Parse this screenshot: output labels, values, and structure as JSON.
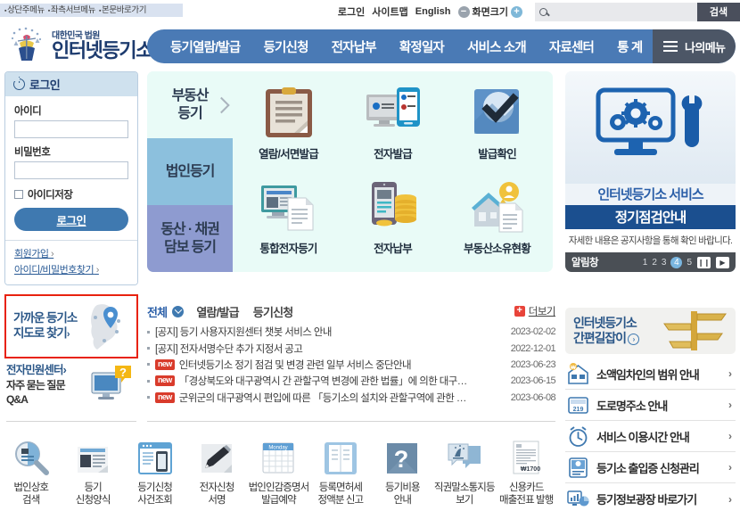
{
  "skip_links": [
    "상단주메뉴",
    "좌측서브메뉴",
    "본문바로가기"
  ],
  "utility": {
    "login": "로그인",
    "sitemap": "사이트맵",
    "english": "English",
    "zoom_label": "화면크기",
    "zoom_out": "−",
    "zoom_in": "+",
    "search_placeholder": "",
    "search_value": "",
    "search_button": "검색"
  },
  "logo": {
    "sub": "대한민국 법원",
    "main": "인터넷등기소"
  },
  "nav": {
    "items": [
      "등기열람/발급",
      "등기신청",
      "전자납부",
      "확정일자",
      "서비스 소개",
      "자료센터",
      "통 계"
    ],
    "mymenu": "나의메뉴"
  },
  "login_panel": {
    "title": "로그인",
    "id_label": "아이디",
    "id_value": "",
    "pw_label": "비밀번호",
    "pw_value": "",
    "remember_label": "아이디저장",
    "submit": "로그인",
    "links": [
      "회원가입",
      "아이디/비밀번호찾기"
    ]
  },
  "sidebar": {
    "map_promo": {
      "line1": "가까운 등기소",
      "line2": "지도로 찾기",
      "arrow": "›"
    },
    "eminwon": {
      "line1": "전자민원센터",
      "arrow": "›",
      "line2": "자주 묻는 질문",
      "line3": "Q&A"
    }
  },
  "visual": {
    "tabs": [
      {
        "label": "부동산\n등기",
        "active": true
      },
      {
        "label": "법인등기",
        "active": false
      },
      {
        "label": "동산 · 채권\n담보 등기",
        "active": false
      }
    ],
    "cells": [
      {
        "label": "열람/서면발급",
        "icon": "clipboard-document-icon"
      },
      {
        "label": "전자발급",
        "icon": "monitor-mobile-icon"
      },
      {
        "label": "발급확인",
        "icon": "checkmark-icon"
      },
      {
        "label": "통합전자등기",
        "icon": "monitor-paper-icon"
      },
      {
        "label": "전자납부",
        "icon": "mobile-coins-icon"
      },
      {
        "label": "부동산소유현황",
        "icon": "house-person-icon"
      }
    ]
  },
  "rbanner": {
    "title1": "인터넷등기소 서비스",
    "title2": "정기점검안내",
    "desc": "자세한 내용은 공지사항을 통해 확인 바랍니다.",
    "bar_label": "알림창",
    "pages": [
      "1",
      "2",
      "3",
      "4",
      "5"
    ],
    "active_page": "4",
    "pause": "❙❙",
    "next": "▶"
  },
  "notice": {
    "tabs": [
      {
        "label": "전체",
        "active": true
      },
      {
        "label": "열람/발급",
        "active": false
      },
      {
        "label": "등기신청",
        "active": false
      }
    ],
    "more_label": "더보기",
    "more_plus": "+",
    "items": [
      {
        "badge": "",
        "prefix": "[공지]",
        "text": "[공지] 등기 사용자지원센터 챗봇 서비스 안내",
        "date": "2023-02-02"
      },
      {
        "badge": "",
        "prefix": "[공지]",
        "text": "[공지] 전자서명수단 추가 지정서 공고",
        "date": "2022-12-01"
      },
      {
        "badge": "new",
        "prefix": "",
        "text": "인터넷등기소 정기 점검 및 변경 관련 일부 서비스 중단안내",
        "date": "2023-06-23"
      },
      {
        "badge": "new",
        "prefix": "",
        "text": "「경상북도와 대구광역시 간 관할구역 변경에 관한 법률」에 의한 대구…",
        "date": "2023-06-15"
      },
      {
        "badge": "new",
        "prefix": "",
        "text": "군위군의 대구광역시 편입에 따른 「등기소의 설치와 관할구역에 관한 …",
        "date": "2023-06-08"
      }
    ]
  },
  "guide": {
    "card_line1": "인터넷등기소",
    "card_line2": "간편길잡이",
    "card_arrow": "›",
    "items": [
      {
        "label": "소액임차인의 범위 안내",
        "icon": "house-won-icon",
        "chevron": "›"
      },
      {
        "label": "도로명주소 안내",
        "icon": "address-plate-icon",
        "chevron": "›"
      },
      {
        "label": "서비스 이용시간 안내",
        "icon": "alarm-clock-icon",
        "chevron": "›"
      },
      {
        "label": "등기소 출입증 신청관리",
        "icon": "id-badge-icon",
        "chevron": "›"
      },
      {
        "label": "등기정보광장 바로가기",
        "icon": "chart-monitor-icon",
        "chevron": "›"
      }
    ]
  },
  "quick": {
    "items": [
      {
        "label": "법인상호\n검색",
        "icon": "magnifier-icon"
      },
      {
        "label": "등기\n신청양식",
        "icon": "form-document-icon"
      },
      {
        "label": "등기신청\n사건조회",
        "icon": "browser-mobile-icon"
      },
      {
        "label": "전자신청\n서명",
        "icon": "pen-sign-icon"
      },
      {
        "label": "법인인감증명서\n발급예약",
        "icon": "calendar-icon"
      },
      {
        "label": "등록면허세\n정액분 신고",
        "icon": "book-icon"
      },
      {
        "label": "등기비용\n안내",
        "icon": "question-icon"
      },
      {
        "label": "직권말소통지등\n보기",
        "icon": "speech-bubbles-icon"
      },
      {
        "label": "신용카드\n매출전표 발행",
        "icon": "receipt-icon"
      }
    ],
    "receipt_amount": "₩1700"
  },
  "colors": {
    "nav_blue": "#4a7ab5",
    "mymenu_gray": "#4c5666",
    "visual_bg": "#e9fbf7",
    "tab2": "#8cc0dd",
    "tab3": "#8e9bd0",
    "accent_red": "#e8220f",
    "badge_red": "#d93b2b",
    "deep_blue": "#1b4f8f"
  }
}
